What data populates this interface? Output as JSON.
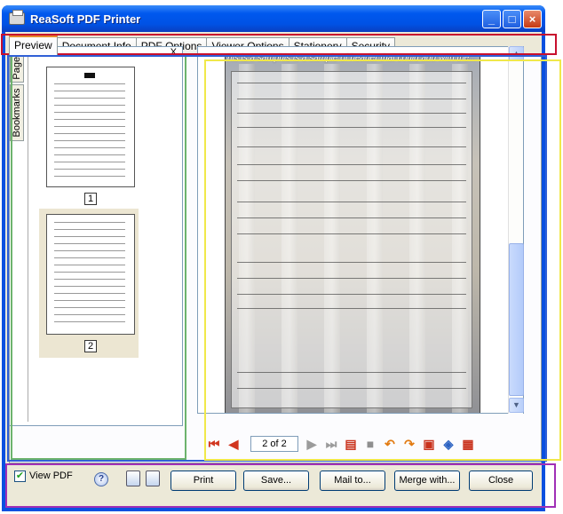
{
  "window": {
    "title": "ReaSoft PDF Printer",
    "min_label": "_",
    "max_label": "□",
    "close_label": "×"
  },
  "tabs": [
    {
      "label": "Preview"
    },
    {
      "label": "Document Info"
    },
    {
      "label": "PDF Options"
    },
    {
      "label": "Viewer Options"
    },
    {
      "label": "Stationery"
    },
    {
      "label": "Security"
    }
  ],
  "sidebar": {
    "tab_pages": "Pages",
    "tab_bookmarks": "Bookmarks",
    "close_label": "X",
    "thumbnails": [
      {
        "page_label": "1"
      },
      {
        "page_label": "2"
      }
    ]
  },
  "preview": {
    "header_text": "his is a samphis is a sample of header that could add with the...",
    "page_indicator": "2 of 2",
    "vscroll_up": "▲",
    "vscroll_down": "▼"
  },
  "footer": {
    "view_pdf_label": "View PDF",
    "view_pdf_checked": "✔",
    "help_icon": "?",
    "buttons": {
      "print": "Print",
      "save": "Save...",
      "mail": "Mail to...",
      "merge": "Merge with...",
      "close": "Close"
    }
  },
  "colors": {
    "annotation_red": "#c8102e",
    "annotation_green": "#6db36d",
    "annotation_blue": "#2f5fd6",
    "annotation_yellow": "#f0e84a",
    "annotation_purple": "#a02fb6"
  }
}
